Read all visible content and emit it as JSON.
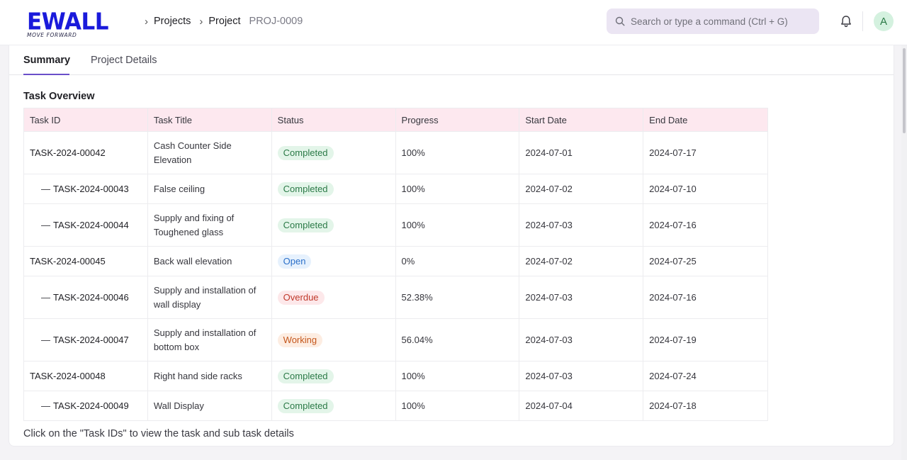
{
  "brand": {
    "name": "EWALL",
    "tagline": "MOVE FORWARD"
  },
  "breadcrumb": [
    {
      "label": "Projects",
      "muted": false
    },
    {
      "label": "Project",
      "muted": false
    },
    {
      "label": "PROJ-0009",
      "muted": true
    }
  ],
  "search": {
    "placeholder": "Search or type a command (Ctrl + G)"
  },
  "user": {
    "avatar_initial": "A"
  },
  "tabs": [
    {
      "label": "Summary",
      "active": true
    },
    {
      "label": "Project Details",
      "active": false
    }
  ],
  "section_title": "Task Overview",
  "table": {
    "columns": [
      "Task ID",
      "Task Title",
      "Status",
      "Progress",
      "Start Date",
      "End Date"
    ],
    "rows": [
      {
        "task_id": "TASK-2024-00042",
        "subtask": false,
        "title": "Cash Counter Side Elevation",
        "status": "Completed",
        "status_key": "completed",
        "progress": "100%",
        "start": "2024-07-01",
        "end": "2024-07-17",
        "tall": true
      },
      {
        "task_id": "TASK-2024-00043",
        "subtask": true,
        "title": "False ceiling",
        "status": "Completed",
        "status_key": "completed",
        "progress": "100%",
        "start": "2024-07-02",
        "end": "2024-07-10",
        "tall": false
      },
      {
        "task_id": "TASK-2024-00044",
        "subtask": true,
        "title": "Supply and fixing of Toughened glass",
        "status": "Completed",
        "status_key": "completed",
        "progress": "100%",
        "start": "2024-07-03",
        "end": "2024-07-16",
        "tall": true
      },
      {
        "task_id": "TASK-2024-00045",
        "subtask": false,
        "title": "Back wall elevation",
        "status": "Open",
        "status_key": "open",
        "progress": "0%",
        "start": "2024-07-02",
        "end": "2024-07-25",
        "tall": false
      },
      {
        "task_id": "TASK-2024-00046",
        "subtask": true,
        "title": "Supply and installation of wall display",
        "status": "Overdue",
        "status_key": "overdue",
        "progress": "52.38%",
        "start": "2024-07-03",
        "end": "2024-07-16",
        "tall": true
      },
      {
        "task_id": "TASK-2024-00047",
        "subtask": true,
        "title": "Supply and installation of bottom box",
        "status": "Working",
        "status_key": "working",
        "progress": "56.04%",
        "start": "2024-07-03",
        "end": "2024-07-19",
        "tall": true
      },
      {
        "task_id": "TASK-2024-00048",
        "subtask": false,
        "title": "Right hand side racks",
        "status": "Completed",
        "status_key": "completed",
        "progress": "100%",
        "start": "2024-07-03",
        "end": "2024-07-24",
        "tall": false
      },
      {
        "task_id": "TASK-2024-00049",
        "subtask": true,
        "title": "Wall Display",
        "status": "Completed",
        "status_key": "completed",
        "progress": "100%",
        "start": "2024-07-04",
        "end": "2024-07-18",
        "tall": false
      }
    ]
  },
  "footnote": "Click on the \"Task IDs\" to view the task and sub task details",
  "icons": {
    "search": "search-icon",
    "notifications": "bell-icon"
  },
  "colors": {
    "brand": "#1a1adb",
    "tab_accent": "#6a4fc9",
    "table_header": "#fde8ef"
  }
}
